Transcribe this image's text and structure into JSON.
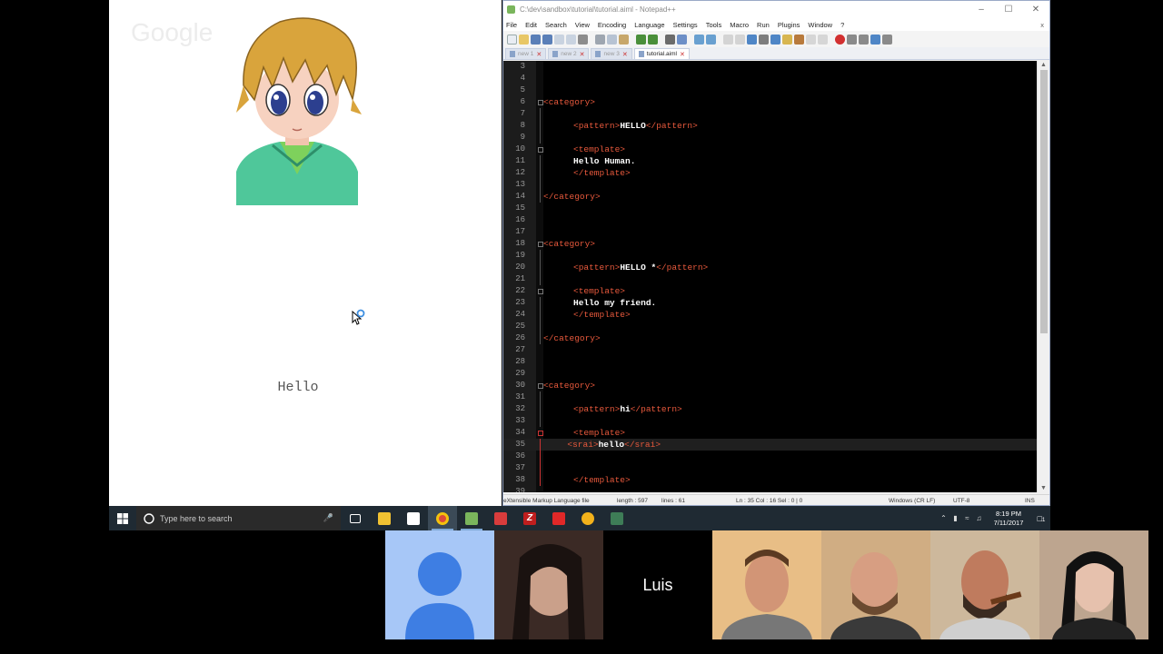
{
  "browser": {
    "logo_text": "Google",
    "bot_reply": "Hello"
  },
  "notepad": {
    "title": "C:\\dev\\sandbox\\tutorial\\tutorial.aiml - Notepad++",
    "menu": [
      "File",
      "Edit",
      "Search",
      "View",
      "Encoding",
      "Language",
      "Settings",
      "Tools",
      "Macro",
      "Run",
      "Plugins",
      "Window",
      "?"
    ],
    "close_x": "x",
    "tabs": [
      {
        "label": "new 1",
        "active": false
      },
      {
        "label": "new 2",
        "active": false
      },
      {
        "label": "new 3",
        "active": false
      },
      {
        "label": "tutorial.aiml",
        "active": true
      }
    ],
    "lines": [
      {
        "n": "3",
        "segs": []
      },
      {
        "n": "4",
        "segs": []
      },
      {
        "n": "5",
        "segs": []
      },
      {
        "n": "6",
        "segs": [
          {
            "t": "tag",
            "v": "<category>"
          }
        ],
        "fold": "box",
        "ind": 0
      },
      {
        "n": "7",
        "segs": [],
        "fold": "line"
      },
      {
        "n": "8",
        "segs": [
          {
            "t": "tag",
            "v": "<pattern>"
          },
          {
            "t": "txt",
            "v": "HELLO"
          },
          {
            "t": "tag",
            "v": "</pattern>"
          }
        ],
        "fold": "line",
        "ind": 5
      },
      {
        "n": "9",
        "segs": [],
        "fold": "line"
      },
      {
        "n": "10",
        "segs": [
          {
            "t": "tag",
            "v": "<template>"
          }
        ],
        "fold": "box",
        "ind": 5
      },
      {
        "n": "11",
        "segs": [
          {
            "t": "txt",
            "v": "Hello Human."
          }
        ],
        "fold": "line",
        "ind": 5
      },
      {
        "n": "12",
        "segs": [
          {
            "t": "tag",
            "v": "</template>"
          }
        ],
        "fold": "line",
        "ind": 5
      },
      {
        "n": "13",
        "segs": [],
        "fold": "line"
      },
      {
        "n": "14",
        "segs": [
          {
            "t": "tag",
            "v": "</category>"
          }
        ],
        "fold": "line",
        "ind": 0
      },
      {
        "n": "15",
        "segs": []
      },
      {
        "n": "16",
        "segs": []
      },
      {
        "n": "17",
        "segs": []
      },
      {
        "n": "18",
        "segs": [
          {
            "t": "tag",
            "v": "<category>"
          }
        ],
        "fold": "box",
        "ind": 0
      },
      {
        "n": "19",
        "segs": [],
        "fold": "line"
      },
      {
        "n": "20",
        "segs": [
          {
            "t": "tag",
            "v": "<pattern>"
          },
          {
            "t": "txt",
            "v": "HELLO *"
          },
          {
            "t": "tag",
            "v": "</pattern>"
          }
        ],
        "fold": "line",
        "ind": 5
      },
      {
        "n": "21",
        "segs": [],
        "fold": "line"
      },
      {
        "n": "22",
        "segs": [
          {
            "t": "tag",
            "v": "<template>"
          }
        ],
        "fold": "box",
        "ind": 5
      },
      {
        "n": "23",
        "segs": [
          {
            "t": "txt",
            "v": "Hello my friend."
          }
        ],
        "fold": "line",
        "ind": 5
      },
      {
        "n": "24",
        "segs": [
          {
            "t": "tag",
            "v": "</template>"
          }
        ],
        "fold": "line",
        "ind": 5
      },
      {
        "n": "25",
        "segs": [],
        "fold": "line"
      },
      {
        "n": "26",
        "segs": [
          {
            "t": "tag",
            "v": "</category>"
          }
        ],
        "fold": "line",
        "ind": 0
      },
      {
        "n": "27",
        "segs": []
      },
      {
        "n": "28",
        "segs": []
      },
      {
        "n": "29",
        "segs": []
      },
      {
        "n": "30",
        "segs": [
          {
            "t": "tag",
            "v": "<category>"
          }
        ],
        "fold": "box",
        "ind": 0
      },
      {
        "n": "31",
        "segs": [],
        "fold": "line"
      },
      {
        "n": "32",
        "segs": [
          {
            "t": "tag",
            "v": "<pattern>"
          },
          {
            "t": "txt",
            "v": "hi"
          },
          {
            "t": "tag",
            "v": "</pattern>"
          }
        ],
        "fold": "line",
        "ind": 5
      },
      {
        "n": "33",
        "segs": [],
        "fold": "line"
      },
      {
        "n": "34",
        "segs": [
          {
            "t": "tag",
            "v": "<template>"
          }
        ],
        "fold": "redbox",
        "ind": 5
      },
      {
        "n": "35",
        "segs": [
          {
            "t": "tag",
            "v": "<srai>"
          },
          {
            "t": "txt",
            "v": "hello"
          },
          {
            "t": "tag",
            "v": "</srai>"
          }
        ],
        "fold": "redline",
        "ind": 4,
        "current": true
      },
      {
        "n": "36",
        "segs": [],
        "fold": "redline"
      },
      {
        "n": "37",
        "segs": [],
        "fold": "redline"
      },
      {
        "n": "38",
        "segs": [
          {
            "t": "tag",
            "v": "</template>"
          }
        ],
        "fold": "redline",
        "ind": 5
      },
      {
        "n": "39",
        "segs": []
      }
    ],
    "status": {
      "type": "eXtensible Markup Language file",
      "length": "length : 597",
      "lines": "lines : 61",
      "pos": "Ln : 35    Col : 16    Sel : 0 | 0",
      "eol": "Windows (CR LF)",
      "enc": "UTF-8",
      "ins": "INS"
    }
  },
  "taskbar": {
    "search_placeholder": "Type here to search",
    "time": "8:19 PM",
    "date": "7/11/2017",
    "notif_count": "1"
  },
  "video": {
    "luis_label": "Luis"
  },
  "colors": {
    "tag": "#e8593c",
    "text": "#ffffff",
    "taskbar": "#1f2a33",
    "participant_bg": "#a7c7f7"
  }
}
